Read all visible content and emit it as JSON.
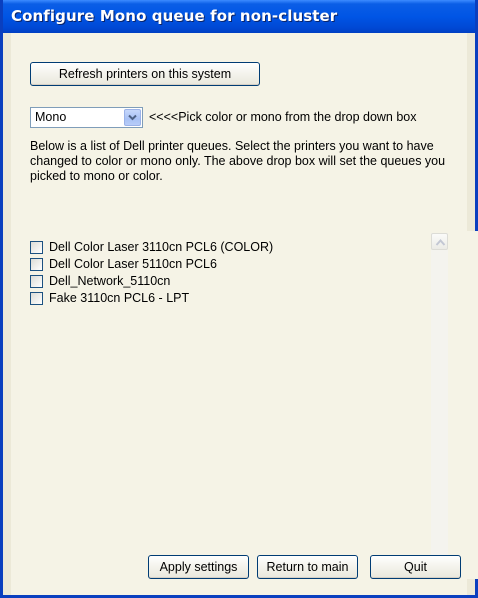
{
  "window": {
    "title": "Configure Mono queue for non-cluster"
  },
  "toolbar": {
    "refresh_label": "Refresh printers on this system"
  },
  "mode": {
    "selected": "Mono",
    "hint": "<<<<Pick color or mono from the drop down box"
  },
  "description": "Below is a list of Dell printer queues. Select the printers you want to have changed to color or mono only. The above drop box will set the queues you picked to mono or color.",
  "printers": [
    {
      "label": "Dell Color Laser 3110cn PCL6 (COLOR)",
      "checked": false
    },
    {
      "label": "Dell Color Laser 5110cn PCL6",
      "checked": false
    },
    {
      "label": "Dell_Network_5110cn",
      "checked": false
    },
    {
      "label": "Fake 3110cn PCL6 - LPT",
      "checked": false
    }
  ],
  "buttons": {
    "apply_label": "Apply settings",
    "return_label": "Return to main",
    "quit_label": "Quit"
  },
  "icons": {
    "dropdown": "chevron-down-icon",
    "scroll_up": "scroll-up-icon",
    "scroll_down": "scroll-down-icon"
  },
  "colors": {
    "titlebar": "#0055e5",
    "border": "#0a3fbf",
    "background": "#f5f3e6"
  }
}
